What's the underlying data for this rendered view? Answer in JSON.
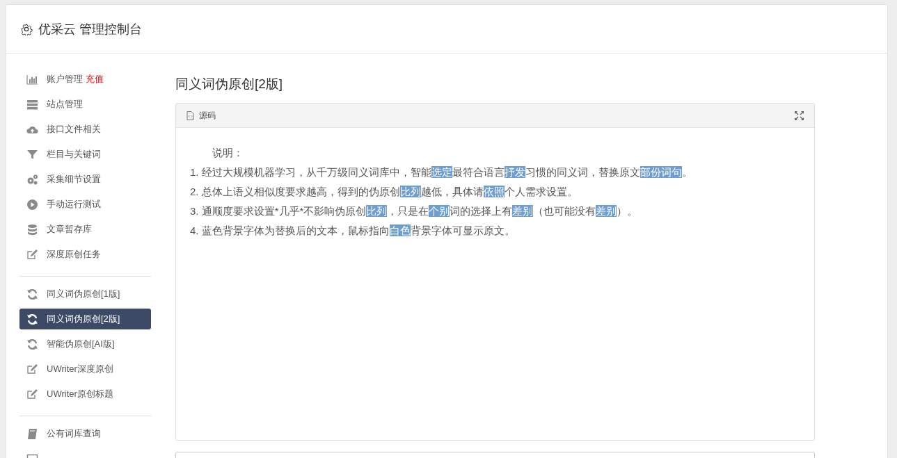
{
  "header": {
    "title": "优采云 管理控制台"
  },
  "sidebar": {
    "groups": [
      {
        "items": [
          {
            "label": "账户管理",
            "kind": "chart",
            "badge": "充值",
            "selected": false
          },
          {
            "label": "站点管理",
            "kind": "server",
            "selected": false
          },
          {
            "label": "接口文件相关",
            "kind": "cloud",
            "selected": false
          },
          {
            "label": "栏目与关键词",
            "kind": "filter",
            "selected": false
          },
          {
            "label": "采集细节设置",
            "kind": "gears",
            "selected": false
          },
          {
            "label": "手动运行测试",
            "kind": "play",
            "selected": false
          },
          {
            "label": "文章暂存库",
            "kind": "database",
            "selected": false
          },
          {
            "label": "深度原创任务",
            "kind": "edit",
            "selected": false
          }
        ]
      },
      {
        "items": [
          {
            "label": "同义词伪原创[1版]",
            "kind": "refresh",
            "selected": false
          },
          {
            "label": "同义词伪原创[2版]",
            "kind": "refresh",
            "selected": true
          },
          {
            "label": "智能伪原创[AI版]",
            "kind": "refresh",
            "selected": false
          },
          {
            "label": "UWriter深度原创",
            "kind": "edit",
            "selected": false
          },
          {
            "label": "UWriter原创标题",
            "kind": "edit",
            "selected": false
          }
        ]
      },
      {
        "items": [
          {
            "label": "公有词库查询",
            "kind": "book",
            "selected": false
          },
          {
            "kind": "square",
            "selected": false
          }
        ]
      }
    ]
  },
  "main": {
    "title": "同义词伪原创[2版]",
    "panel": {
      "tab": "源码",
      "heading": "说明：",
      "lines": [
        [
          {
            "text": "1. 经过大规模机器学习，从千万级同义词库中，智能",
            "highlighted": false
          },
          {
            "text": "选定",
            "highlighted": true
          },
          {
            "text": "最符合语言",
            "highlighted": false
          },
          {
            "text": "抒发",
            "highlighted": true
          },
          {
            "text": "习惯的同义词，替换原文",
            "highlighted": false
          },
          {
            "text": "部份",
            "highlighted": true
          },
          {
            "text": "词句",
            "highlighted": true
          },
          {
            "text": "。",
            "highlighted": false
          }
        ],
        [
          {
            "text": "2. 总体上语义相似度要求越高，得到的伪原创",
            "highlighted": false
          },
          {
            "text": "比列",
            "highlighted": true
          },
          {
            "text": "越低，具体请",
            "highlighted": false
          },
          {
            "text": "依照",
            "highlighted": true
          },
          {
            "text": "个人需求设置。",
            "highlighted": false
          }
        ],
        [
          {
            "text": "3. 通顺度要求设置*几乎*不影响伪原创",
            "highlighted": false
          },
          {
            "text": "比列",
            "highlighted": true
          },
          {
            "text": "，只是在",
            "highlighted": false
          },
          {
            "text": "个别",
            "highlighted": true
          },
          {
            "text": "词的选择上有",
            "highlighted": false
          },
          {
            "text": "差别",
            "highlighted": true
          },
          {
            "text": "（也可能没有",
            "highlighted": false
          },
          {
            "text": "差别",
            "highlighted": true
          },
          {
            "text": "）。",
            "highlighted": false
          }
        ],
        [
          {
            "text": "4. 蓝色背景字体为替换后的文本，鼠标指向",
            "highlighted": false
          },
          {
            "text": "白色",
            "highlighted": true
          },
          {
            "text": "背景字体可显示原文。",
            "highlighted": false
          }
        ]
      ]
    }
  }
}
